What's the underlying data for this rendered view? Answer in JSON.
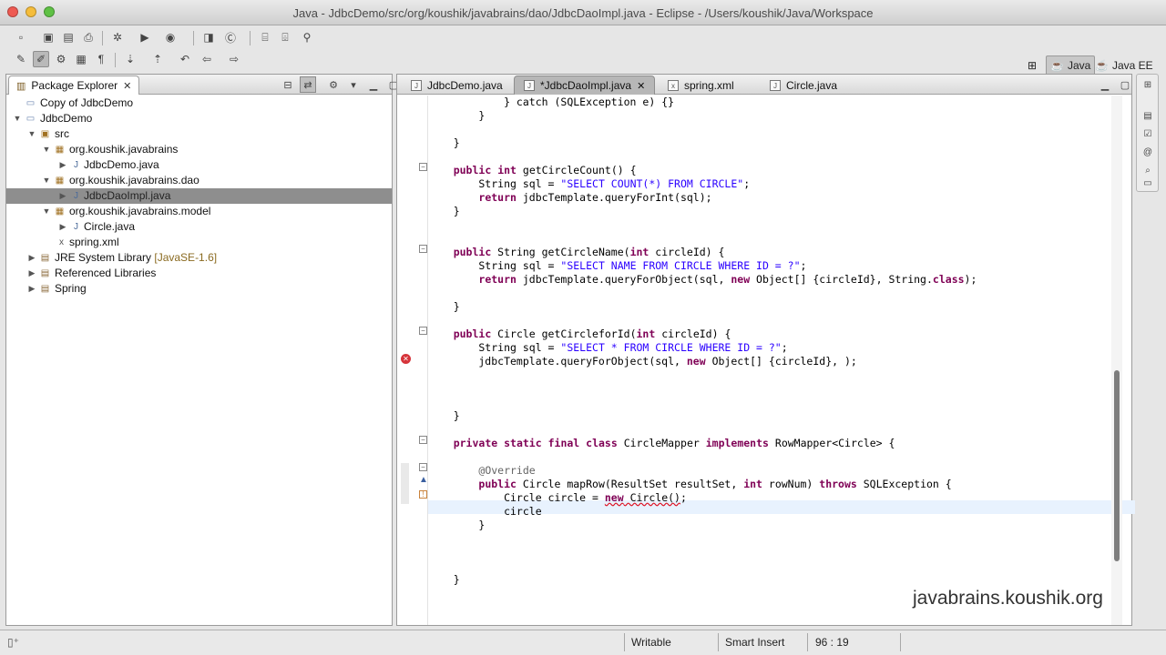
{
  "window": {
    "title": "Java - JdbcDemo/src/org/koushik/javabrains/dao/JdbcDaoImpl.java - Eclipse - /Users/koushik/Java/Workspace"
  },
  "perspectives": {
    "java": "Java",
    "java_ee": "Java EE"
  },
  "package_explorer": {
    "tab_label": "Package Explorer",
    "tree": [
      {
        "label": "Copy of JdbcDemo",
        "icon": "project-icon"
      },
      {
        "label": "JdbcDemo",
        "icon": "project-icon"
      },
      {
        "label": "src",
        "icon": "source-folder-icon"
      },
      {
        "label": "org.koushik.javabrains",
        "icon": "package-icon"
      },
      {
        "label": "JdbcDemo.java",
        "icon": "java-file-icon"
      },
      {
        "label": "org.koushik.javabrains.dao",
        "icon": "package-icon"
      },
      {
        "label": "JdbcDaoImpl.java",
        "icon": "java-file-icon"
      },
      {
        "label": "org.koushik.javabrains.model",
        "icon": "package-icon"
      },
      {
        "label": "Circle.java",
        "icon": "java-file-icon"
      },
      {
        "label": "spring.xml",
        "icon": "xml-file-icon"
      },
      {
        "label": "JRE System Library",
        "decoration": "[JavaSE-1.6]",
        "icon": "library-icon"
      },
      {
        "label": "Referenced Libraries",
        "icon": "library-icon"
      },
      {
        "label": "Spring",
        "icon": "library-icon"
      }
    ]
  },
  "editor": {
    "tabs": [
      {
        "label": "JdbcDemo.java"
      },
      {
        "label": "*JdbcDaoImpl.java"
      },
      {
        "label": "spring.xml"
      },
      {
        "label": "Circle.java"
      }
    ],
    "code_lines": [
      "            } catch (SQLException e) {}",
      "        }",
      "",
      "    }",
      "",
      "    public int getCircleCount() {",
      "        String sql = \"SELECT COUNT(*) FROM CIRCLE\";",
      "        return jdbcTemplate.queryForInt(sql);",
      "    }",
      "",
      "",
      "    public String getCircleName(int circleId) {",
      "        String sql = \"SELECT NAME FROM CIRCLE WHERE ID = ?\";",
      "        return jdbcTemplate.queryForObject(sql, new Object[] {circleId}, String.class);",
      "",
      "    }",
      "",
      "    public Circle getCircleforId(int circleId) {",
      "        String sql = \"SELECT * FROM CIRCLE WHERE ID = ?\";",
      "        jdbcTemplate.queryForObject(sql, new Object[] {circleId}, );",
      "",
      "",
      "",
      "    }",
      "",
      "    private static final class CircleMapper implements RowMapper<Circle> {",
      "",
      "        @Override",
      "        public Circle mapRow(ResultSet resultSet, int rowNum) throws SQLException {",
      "            Circle circle = new Circle();",
      "            circle ",
      "        }",
      "",
      "",
      "",
      "    }"
    ]
  },
  "watermark": "javabrains.koushik.org",
  "status": {
    "writable": "Writable",
    "insert_mode": "Smart Insert",
    "position": "96 : 19"
  }
}
